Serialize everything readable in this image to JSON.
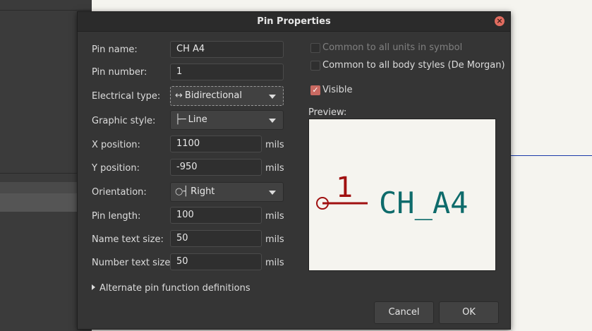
{
  "dialog": {
    "title": "Pin Properties"
  },
  "fields": {
    "pin_name": {
      "label": "Pin name:",
      "value": "CH A4"
    },
    "pin_number": {
      "label": "Pin number:",
      "value": "1"
    },
    "electrical_type": {
      "label": "Electrical type:",
      "glyph": "↔",
      "value": "Bidirectional"
    },
    "graphic_style": {
      "label": "Graphic style:",
      "glyph": "├─",
      "value": "Line"
    },
    "x_position": {
      "label": "X position:",
      "value": "1100",
      "unit": "mils"
    },
    "y_position": {
      "label": "Y position:",
      "value": "-950",
      "unit": "mils"
    },
    "orientation": {
      "label": "Orientation:",
      "glyph": "○┤",
      "value": "Right"
    },
    "pin_length": {
      "label": "Pin length:",
      "value": "100",
      "unit": "mils"
    },
    "name_text_size": {
      "label": "Name text size:",
      "value": "50",
      "unit": "mils"
    },
    "number_text_size": {
      "label": "Number text size:",
      "value": "50",
      "unit": "mils"
    }
  },
  "options": {
    "common_units": {
      "label": "Common to all units in symbol",
      "checked": false,
      "enabled": false
    },
    "common_body_styles": {
      "label": "Common to all body styles (De Morgan)",
      "checked": false,
      "enabled": true
    },
    "visible": {
      "label": "Visible",
      "checked": true,
      "enabled": true
    }
  },
  "preview": {
    "label": "Preview:",
    "pin_number": "1",
    "pin_name": "CH_A4",
    "colors": {
      "number": "#a01010",
      "name": "#0e6b6b",
      "background": "#f5f4ef"
    }
  },
  "alternate": {
    "label": "Alternate pin function definitions"
  },
  "buttons": {
    "cancel": "Cancel",
    "ok": "OK"
  }
}
